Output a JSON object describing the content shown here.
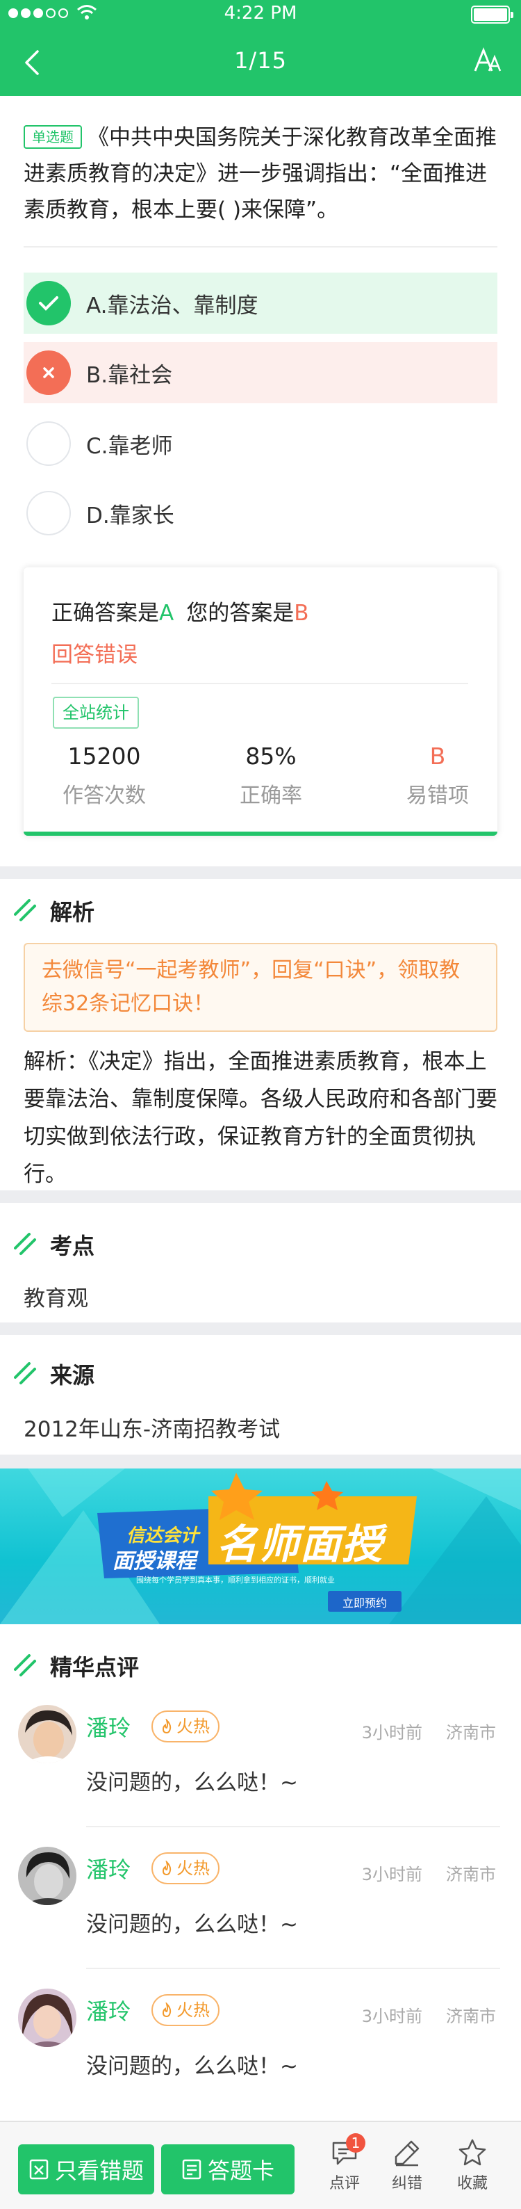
{
  "status_bar": {
    "time": "4:22 PM"
  },
  "nav": {
    "title": "1/15"
  },
  "question": {
    "type_label": "单选题",
    "text": "《中共中央国务院关于深化教育改革全面推进素质教育的决定》进一步强调指出：“全面推进素质教育，根本上要( )来保障”。",
    "options": [
      {
        "label": "A.靠法治、靠制度",
        "state": "correct"
      },
      {
        "label": "B.靠社会",
        "state": "wrong"
      },
      {
        "label": "C.靠老师",
        "state": "none"
      },
      {
        "label": "D.靠家长",
        "state": "none"
      }
    ]
  },
  "result": {
    "correct_prefix": "正确答案是",
    "correct_value": "A",
    "yours_prefix": "您的答案是",
    "yours_value": "B",
    "verdict": "回答错误",
    "stats_tag": "全站统计",
    "stats": [
      {
        "value": "15200",
        "label": "作答次数"
      },
      {
        "value": "85%",
        "label": "正确率"
      },
      {
        "value": "B",
        "label": "易错项"
      }
    ]
  },
  "analysis": {
    "heading": "解析",
    "promo": "去微信号“一起考教师”，回复“口诀”，领取教综32条记忆口诀！",
    "text": "解析：《决定》指出，全面推进素质教育，根本上要靠法治、靠制度保障。各级人民政府和各部门要切实做到依法行政，保证教育方针的全面贯彻执行。"
  },
  "knowledge_point": {
    "heading": "考点",
    "text": "教育观"
  },
  "source": {
    "heading": "来源",
    "text": "2012年山东-济南招教考试"
  },
  "banner": {
    "brand_line1": "信达会计",
    "brand_line2": "面授课程",
    "title": "名师面授",
    "subtitle": "围绕每个学员学到真本事，顺利拿到相应的证书，顺利就业",
    "cta": "立即预约"
  },
  "comments": {
    "heading": "精华点评",
    "items": [
      {
        "name": "潘玲",
        "hot": "火热",
        "time": "3小时前",
        "city": "济南市",
        "text": "没问题的，么么哒！~"
      },
      {
        "name": "潘玲",
        "hot": "火热",
        "time": "3小时前",
        "city": "济南市",
        "text": "没问题的，么么哒！~"
      },
      {
        "name": "潘玲",
        "hot": "火热",
        "time": "3小时前",
        "city": "济南市",
        "text": "没问题的，么么哒！~"
      }
    ]
  },
  "bottom_bar": {
    "wrong_only": "只看错题",
    "answer_card": "答题卡",
    "review": "点评",
    "review_badge": "1",
    "correct_error": "纠错",
    "favorite": "收藏"
  },
  "colors": {
    "accent": "#22c46a",
    "error": "#f36e56",
    "promo": "#f3883a"
  }
}
